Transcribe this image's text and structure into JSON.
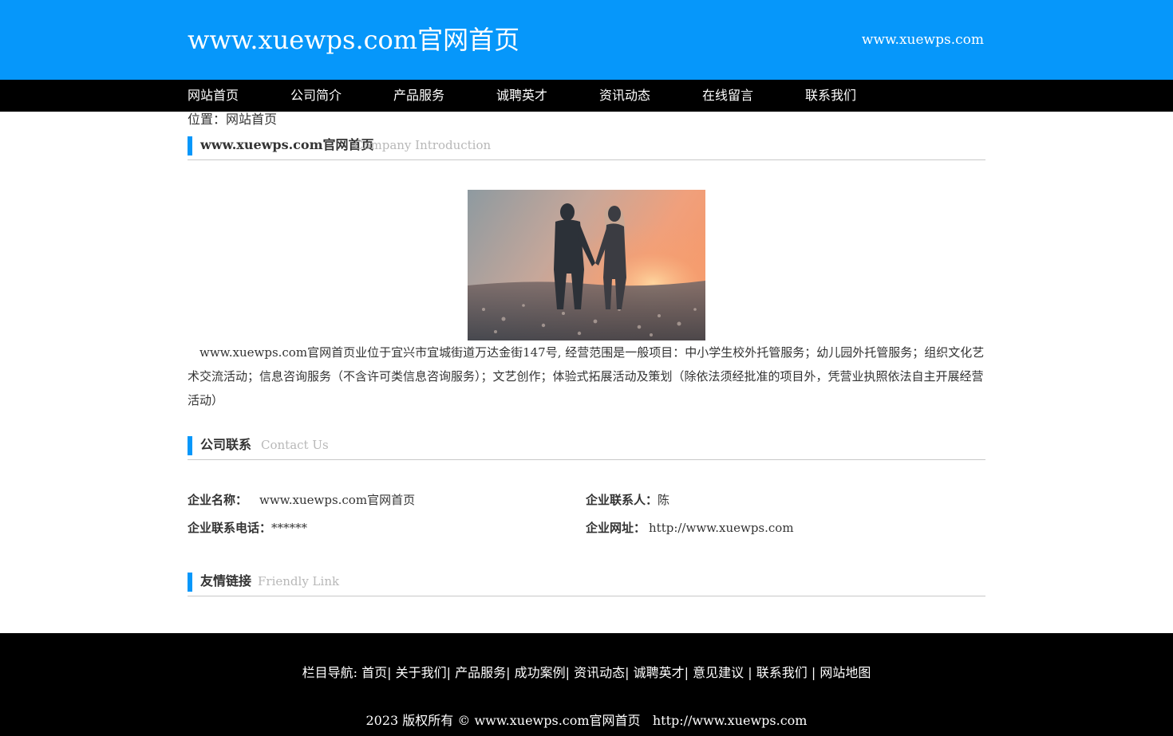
{
  "header": {
    "title": "www.xuewps.com官网首页",
    "domain": "www.xuewps.com"
  },
  "nav": {
    "items": [
      "网站首页",
      "公司简介",
      "产品服务",
      "诚聘英才",
      "资讯动态",
      "在线留言",
      "联系我们"
    ]
  },
  "breadcrumb": "位置：网站首页",
  "intro_section": {
    "title": "www.xuewps.com官网首页",
    "subtitle": "Company Introduction",
    "text": "www.xuewps.com官网首页业位于宜兴市宜城街道万达金街147号, 经营范围是一般项目：中小学生校外托管服务；幼儿园外托管服务；组织文化艺术交流活动；信息咨询服务（不含许可类信息咨询服务）；文艺创作；体验式拓展活动及策划（除依法须经批准的项目外，凭营业执照依法自主开展经营活动）"
  },
  "contact_section": {
    "title": "公司联系",
    "subtitle": "Contact Us",
    "company_name_label": "企业名称：",
    "company_name": "www.xuewps.com官网首页",
    "contact_person_label": "企业联系人：",
    "contact_person": "陈",
    "phone_label": "企业联系电话：",
    "phone": "******",
    "website_label": "企业网址：",
    "website": "http://www.xuewps.com"
  },
  "links_section": {
    "title": "友情链接",
    "subtitle": "Friendly Link"
  },
  "footer": {
    "nav_prefix": "栏目导航: ",
    "nav_items": [
      "首页",
      "关于我们",
      "产品服务",
      "成功案例",
      "资讯动态",
      "诚聘英才",
      "意见建议",
      "联系我们",
      "网站地图"
    ],
    "copyright": "2023 版权所有 © www.xuewps.com官网首页",
    "url": "http://www.xuewps.com"
  },
  "colors": {
    "brand_blue": "#0697fa",
    "nav_black": "#000000"
  }
}
